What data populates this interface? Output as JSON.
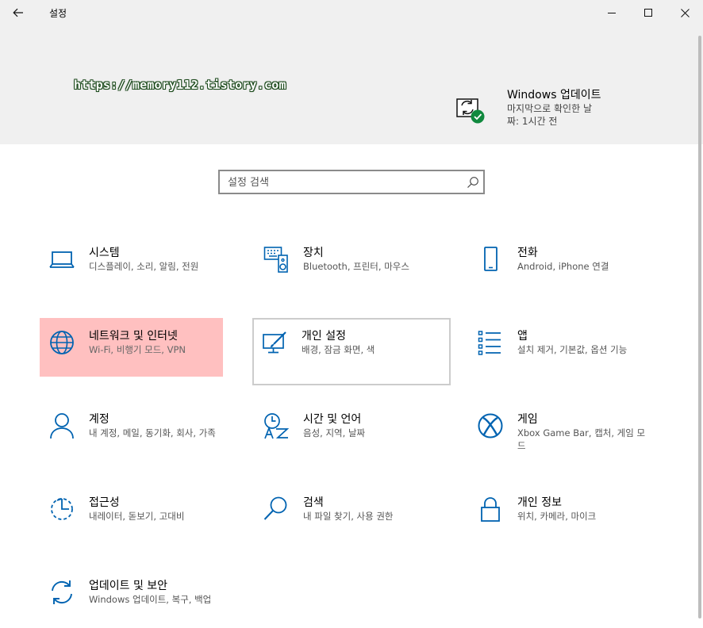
{
  "window": {
    "title": "설정",
    "back_icon": "back-arrow-icon",
    "minimize_icon": "minimize-icon",
    "maximize_icon": "maximize-icon",
    "close_icon": "close-icon"
  },
  "header": {
    "watermark": "https://memory112.tistory.com",
    "update": {
      "icon": "windows-update-icon",
      "title": "Windows 업데이트",
      "line1": "마지막으로 확인한 날",
      "line2": "짜: 1시간 전"
    }
  },
  "search": {
    "placeholder": "설정 검색",
    "icon": "search-icon"
  },
  "accent_color": "#0063b1",
  "highlight_color": "#ffc0c0",
  "tiles": [
    {
      "name": "시스템",
      "desc": "디스플레이, 소리, 알림, 전원",
      "icon": "laptop-icon"
    },
    {
      "name": "장치",
      "desc": "Bluetooth, 프린터, 마우스",
      "icon": "devices-icon"
    },
    {
      "name": "전화",
      "desc": "Android, iPhone 연결",
      "icon": "phone-icon"
    },
    {
      "name": "네트워크 및 인터넷",
      "desc": "Wi-Fi, 비행기 모드, VPN",
      "icon": "globe-icon"
    },
    {
      "name": "개인 설정",
      "desc": "배경, 잠금 화면, 색",
      "icon": "personalization-icon"
    },
    {
      "name": "앱",
      "desc": "설치 제거, 기본값, 옵션 기능",
      "icon": "apps-list-icon"
    },
    {
      "name": "계정",
      "desc": "내 계정, 메일, 동기화, 회사, 가족",
      "icon": "person-icon"
    },
    {
      "name": "시간 및 언어",
      "desc": "음성, 지역, 날짜",
      "icon": "time-language-icon"
    },
    {
      "name": "게임",
      "desc": "Xbox Game Bar, 캡처, 게임 모드",
      "icon": "xbox-icon"
    },
    {
      "name": "접근성",
      "desc": "내레이터, 돋보기, 고대비",
      "icon": "accessibility-icon"
    },
    {
      "name": "검색",
      "desc": "내 파일 찾기, 사용 권한",
      "icon": "magnifier-icon"
    },
    {
      "name": "개인 정보",
      "desc": "위치, 카메라, 마이크",
      "icon": "lock-icon"
    },
    {
      "name": "업데이트 및 보안",
      "desc": "Windows 업데이트, 복구, 백업",
      "icon": "sync-arrows-icon"
    }
  ]
}
